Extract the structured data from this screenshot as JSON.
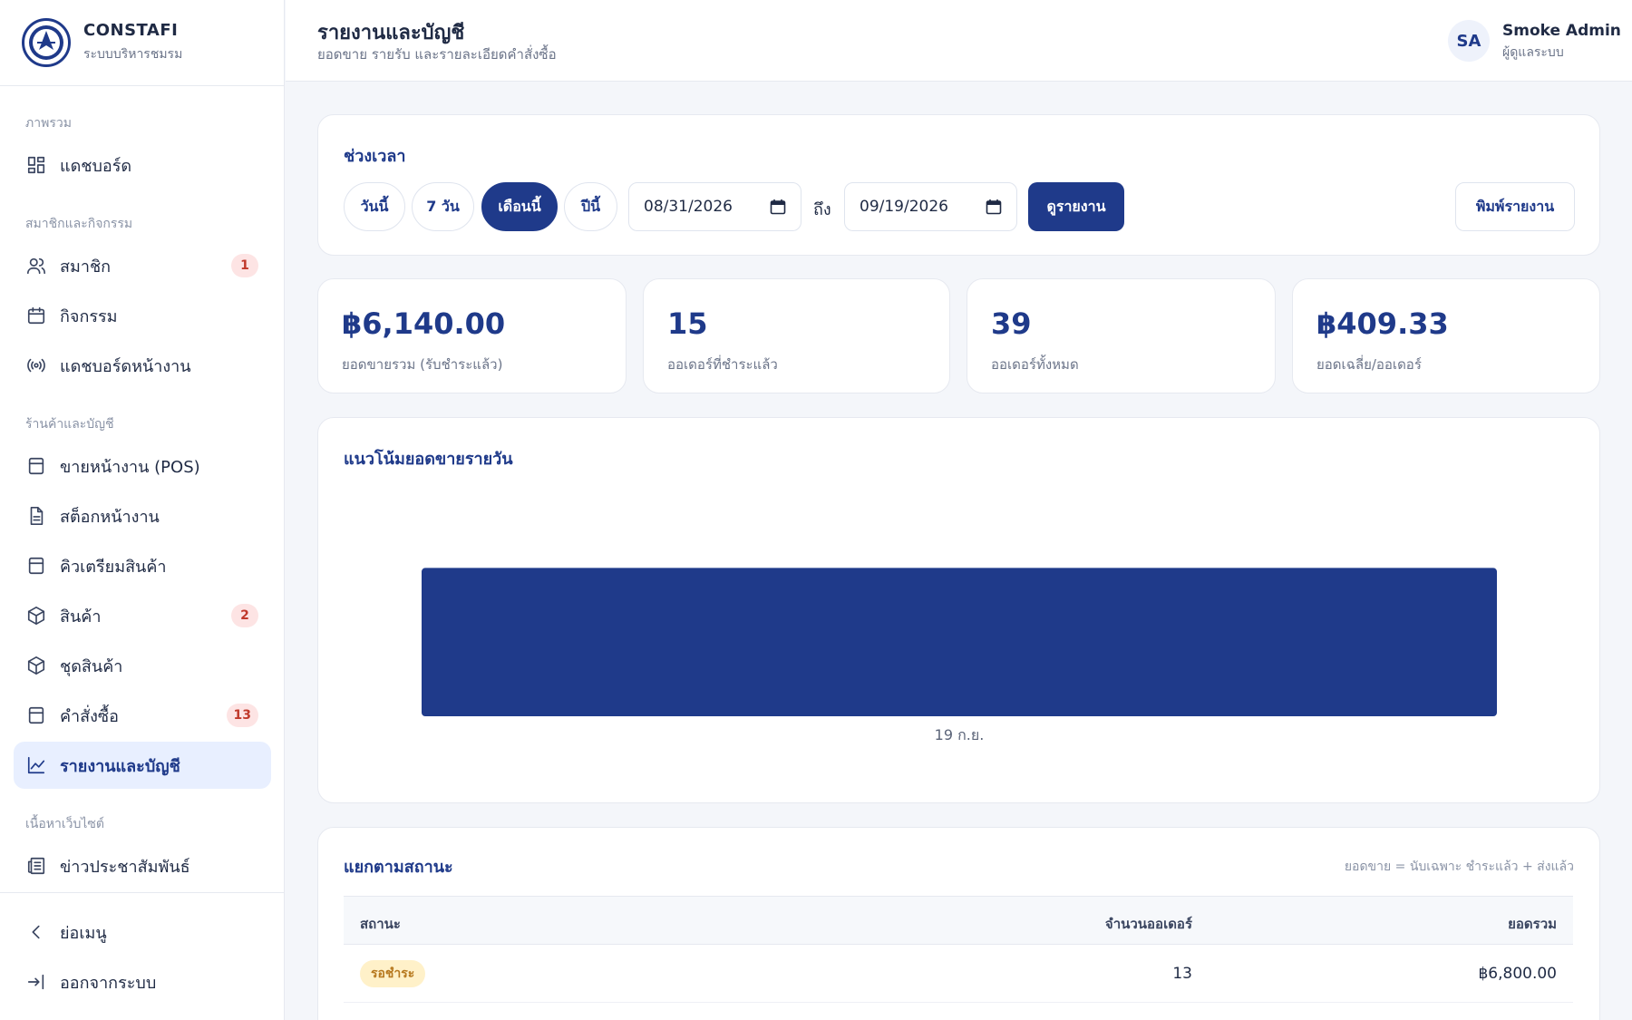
{
  "brand": {
    "name": "CONSTAFI",
    "subtitle": "ระบบบริหารชมรม"
  },
  "header": {
    "title": "รายงานและบัญชี",
    "subtitle": "ยอดขาย รายรับ และรายละเอียดคำสั่งซื้อ"
  },
  "user": {
    "initials": "SA",
    "name": "Smoke Admin",
    "role": "ผู้ดูแลระบบ"
  },
  "sidebar": {
    "sections": [
      "ภาพรวม",
      "สมาชิกและกิจกรรม",
      "ร้านค้าและบัญชี",
      "เนื้อหาเว็บไซต์"
    ],
    "items": [
      {
        "label": "แดชบอร์ด",
        "icon": "dashboard-icon",
        "badge": ""
      },
      {
        "label": "สมาชิก",
        "icon": "users-icon",
        "badge": "1"
      },
      {
        "label": "กิจกรรม",
        "icon": "calendar-icon",
        "badge": ""
      },
      {
        "label": "แดชบอร์ดหน้างาน",
        "icon": "broadcast-icon",
        "badge": ""
      },
      {
        "label": "ขายหน้างาน (POS)",
        "icon": "box-icon",
        "badge": ""
      },
      {
        "label": "สต็อกหน้างาน",
        "icon": "document-icon",
        "badge": ""
      },
      {
        "label": "คิวเตรียมสินค้า",
        "icon": "box-icon",
        "badge": ""
      },
      {
        "label": "สินค้า",
        "icon": "package-icon",
        "badge": "2"
      },
      {
        "label": "ชุดสินค้า",
        "icon": "package-icon",
        "badge": ""
      },
      {
        "label": "คำสั่งซื้อ",
        "icon": "box-icon",
        "badge": "13"
      },
      {
        "label": "รายงานและบัญชี",
        "icon": "chart-line-icon",
        "badge": ""
      },
      {
        "label": "ข่าวประชาสัมพันธ์",
        "icon": "newspaper-icon",
        "badge": ""
      }
    ],
    "footer": [
      {
        "label": "ย่อเมนู",
        "icon": "chevron-left-icon"
      },
      {
        "label": "ออกจากระบบ",
        "icon": "logout-icon"
      }
    ]
  },
  "period": {
    "title": "ช่วงเวลา",
    "presets": [
      "วันนี้",
      "7 วัน",
      "เดือนนี้",
      "ปีนี้"
    ],
    "active_preset": "เดือนนี้",
    "from": "08/31/2026",
    "to_label": "ถึง",
    "to": "09/19/2026",
    "view_button": "ดูรายงาน",
    "print_button": "พิมพ์รายงาน"
  },
  "stats": [
    {
      "value": "฿6,140.00",
      "label": "ยอดขายรวม (รับชำระแล้ว)"
    },
    {
      "value": "15",
      "label": "ออเดอร์ที่ชำระแล้ว"
    },
    {
      "value": "39",
      "label": "ออเดอร์ทั้งหมด"
    },
    {
      "value": "฿409.33",
      "label": "ยอดเฉลี่ย/ออเดอร์"
    }
  ],
  "chart_title": "แนวโน้มยอดขายรายวัน",
  "chart_data": {
    "type": "bar",
    "title": "แนวโน้มยอดขายรายวัน",
    "categories": [
      "19 ก.ย."
    ],
    "values": [
      6140
    ],
    "color": "#1f3a8a",
    "grid": false,
    "legend": "none"
  },
  "status_table": {
    "title": "แยกตามสถานะ",
    "note": "ยอดขาย = นับเฉพาะ ชำระแล้ว + ส่งแล้ว",
    "headers": [
      "สถานะ",
      "จำนวนออเดอร์",
      "ยอดรวม"
    ],
    "rows": [
      {
        "status": "รอชำระ",
        "count": "13",
        "total": "฿6,800.00"
      }
    ]
  },
  "colors": {
    "primary": "#1f3a8a",
    "badge_bg": "#fde4e4",
    "badge_text": "#c0392b",
    "pending_bg": "#fff1c9",
    "pending_text": "#b7791f"
  }
}
